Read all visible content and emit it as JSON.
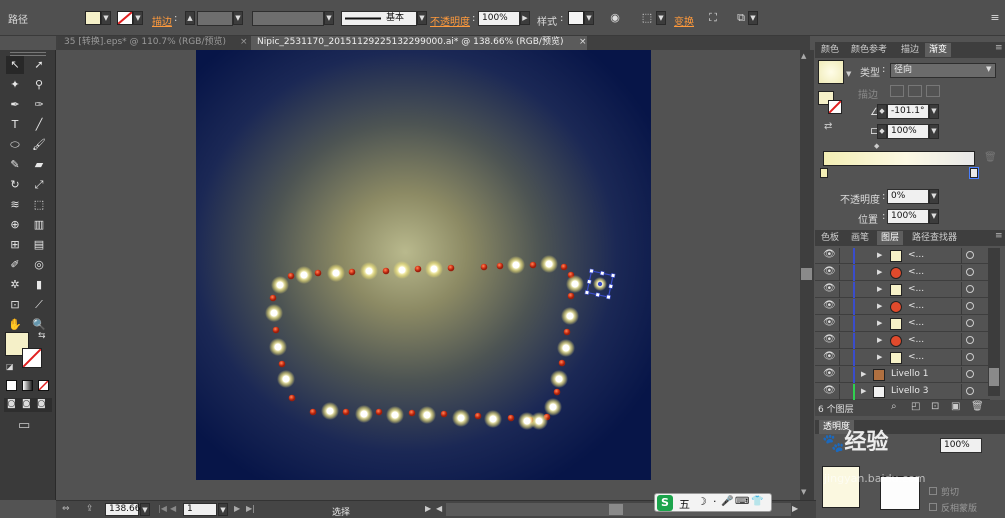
{
  "control_bar": {
    "object_label": "路径",
    "stroke_link": "描边",
    "stroke_colon": ":",
    "brush_label": "基本",
    "opacity_link": "不透明度",
    "opacity_colon": ":",
    "opacity_value": "100%",
    "style_label": "样式",
    "transform_link": "变换"
  },
  "tabs": [
    {
      "label": "35 [转换].eps* @ 110.7% (RGB/预览)",
      "active": false
    },
    {
      "label": "Nipic_2531170_20151129225132299000.ai* @ 138.66% (RGB/预览)",
      "active": true
    }
  ],
  "close_glyph": "×",
  "gradient_panel": {
    "tabs": [
      "颜色",
      "颜色参考",
      "描边",
      "渐变"
    ],
    "active_tab": "渐变",
    "type_label": "类型",
    "type_value": "径向",
    "stroke_label": "描边",
    "angle_value": "-101.1°",
    "aspect_value": "100%",
    "opacity_label": "不透明度",
    "opacity_value": "0%",
    "position_label": "位置",
    "position_value": "100%"
  },
  "layers_panel": {
    "tabs": [
      "色板",
      "画笔",
      "图层",
      "路径查找器"
    ],
    "active_tab": "图层",
    "rows": [
      {
        "name": "<...",
        "thumb": "cream"
      },
      {
        "name": "<...",
        "thumb": "red"
      },
      {
        "name": "<...",
        "thumb": "cream"
      },
      {
        "name": "<...",
        "thumb": "red"
      },
      {
        "name": "<...",
        "thumb": "cream"
      },
      {
        "name": "<...",
        "thumb": "red"
      },
      {
        "name": "<...",
        "thumb": "cream"
      },
      {
        "name": "Livello 1",
        "thumb": "photo"
      },
      {
        "name": "Livello 3",
        "thumb": "white"
      }
    ],
    "count_label": "6 个图层",
    "partial_tab": "透明度",
    "transparency_value": "100%",
    "clip_label": "剪切",
    "invert_mask_label": "反相蒙版"
  },
  "status_bar": {
    "zoom": "138.66",
    "artboard_number": "1",
    "tool_label": "选择"
  },
  "ime_bar": {
    "logo": "S",
    "mode": "五",
    "punct": "·",
    "moon": "☽"
  },
  "watermark": {
    "text": "经验",
    "url": "jingyan.baidu.com"
  },
  "colors": {
    "fill_swatch": "#f5f0c8",
    "bulb_glow": "#fffbd0",
    "bulb_red": "#d84020",
    "selection": "#3a4dcc",
    "orange_link": "#ff9a3c"
  }
}
